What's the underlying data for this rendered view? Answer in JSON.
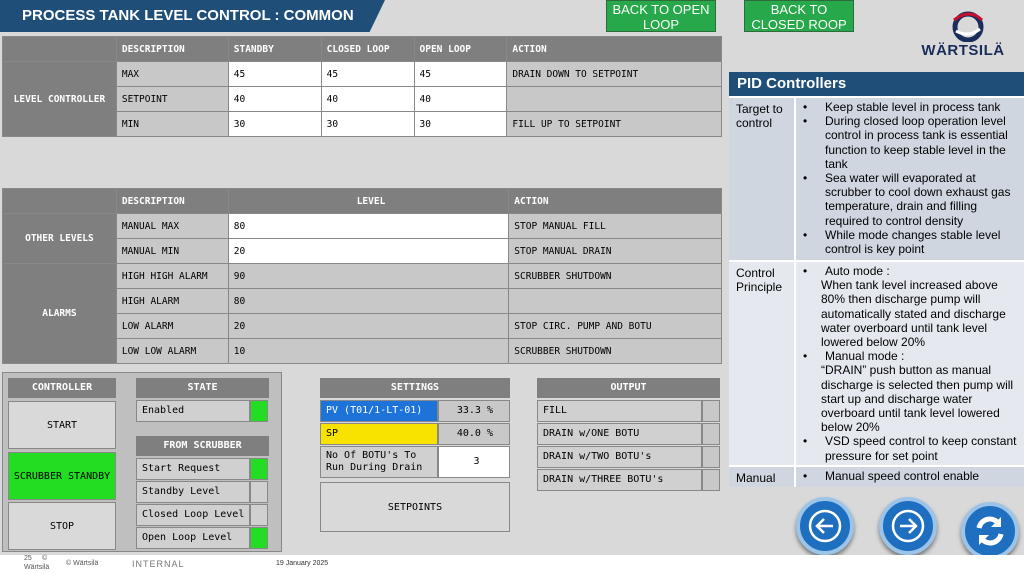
{
  "header": {
    "title": "PROCESS TANK LEVEL CONTROL : COMMON",
    "back_open_loop": "BACK TO OPEN LOOP",
    "back_closed_loop": "BACK TO CLOSED ROOP",
    "logo_text": "WÄRTSILÄ"
  },
  "level_controller": {
    "headers": [
      "DESCRIPTION",
      "STANDBY",
      "CLOSED LOOP",
      "OPEN LOOP",
      "ACTION"
    ],
    "group_label": "LEVEL CONTROLLER",
    "rows": [
      {
        "desc": "MAX",
        "standby": "45",
        "closed": "45",
        "open": "45",
        "action": "DRAIN DOWN TO SETPOINT"
      },
      {
        "desc": "SETPOINT",
        "standby": "40",
        "closed": "40",
        "open": "40",
        "action": ""
      },
      {
        "desc": "MIN",
        "standby": "30",
        "closed": "30",
        "open": "30",
        "action": "FILL UP TO SETPOINT"
      }
    ]
  },
  "other_levels": {
    "headers": [
      "DESCRIPTION",
      "LEVEL",
      "ACTION"
    ],
    "other_label": "OTHER LEVELS",
    "alarms_label": "ALARMS",
    "rows": [
      {
        "desc": "MANUAL MAX",
        "level": "80",
        "action": "STOP MANUAL FILL"
      },
      {
        "desc": "MANUAL MIN",
        "level": "20",
        "action": "STOP MANUAL DRAIN"
      },
      {
        "desc": "HIGH HIGH ALARM",
        "level": "90",
        "action": "SCRUBBER SHUTDOWN"
      },
      {
        "desc": "HIGH ALARM",
        "level": "80",
        "action": ""
      },
      {
        "desc": "LOW ALARM",
        "level": "20",
        "action": "STOP CIRC. PUMP AND BOTU"
      },
      {
        "desc": "LOW LOW ALARM",
        "level": "10",
        "action": "SCRUBBER SHUTDOWN"
      }
    ]
  },
  "controller": {
    "title": "CONTROLLER",
    "start": "START",
    "scrubber_standby": "SCRUBBER STANDBY",
    "stop": "STOP"
  },
  "state": {
    "title": "STATE",
    "enabled": "Enabled",
    "from_scrubber": "FROM SCRUBBER",
    "items": [
      "Start Request",
      "Standby Level",
      "Closed Loop Level",
      "Open Loop Level"
    ]
  },
  "settings": {
    "title": "SETTINGS",
    "pv_label": "PV (T01/1-LT-01)",
    "pv_value": "33.3 %",
    "sp_label": "SP",
    "sp_value": "40.0 %",
    "botu_label": "No Of BOTU's To Run During Drain",
    "botu_value": "3",
    "setpoints": "SETPOINTS"
  },
  "output": {
    "title": "OUTPUT",
    "items": [
      "FILL",
      "DRAIN w/ONE BOTU",
      "DRAIN w/TWO BOTU's",
      "DRAIN w/THREE BOTU's"
    ]
  },
  "pid": {
    "title": "PID Controllers",
    "target_label": "Target to control",
    "target_items": [
      "Keep stable level in process tank",
      "During closed loop operation level control in process tank is essential function to keep stable level in the tank",
      "Sea water will evaporated at scrubber to cool down exhaust gas temperature, drain and filling required to control density",
      "While mode changes stable level control is key point"
    ],
    "principle_label": "Control Principle",
    "principle_items": [
      "Auto mode :",
      "When tank level increased above 80%  then discharge pump will automatically stated and discharge water overboard until tank level lowered below 20%",
      "Manual mode :",
      "“DRAIN” push button as manual discharge is selected then pump will start up and discharge water overboard until tank level lowered below 20%",
      "VSD speed control to keep constant pressure for set point"
    ],
    "manual_label": "Manual",
    "manual_items": [
      "Manual speed control enable"
    ]
  },
  "footer": {
    "page": "25",
    "copy_small": "©",
    "brand_small": "Wärtsilä",
    "copyright": "© Wärtsilä",
    "classification": "INTERNAL",
    "date": "19 January 2025"
  },
  "icons": {
    "prev": "arrow-left-icon",
    "next": "arrow-right-icon",
    "refresh": "refresh-icon"
  },
  "colors": {
    "title_bg": "#1f4e79",
    "green": "#27a84a",
    "active_green": "#22dd22",
    "pv_blue": "#1e73d8",
    "sp_yellow": "#f7e200"
  }
}
